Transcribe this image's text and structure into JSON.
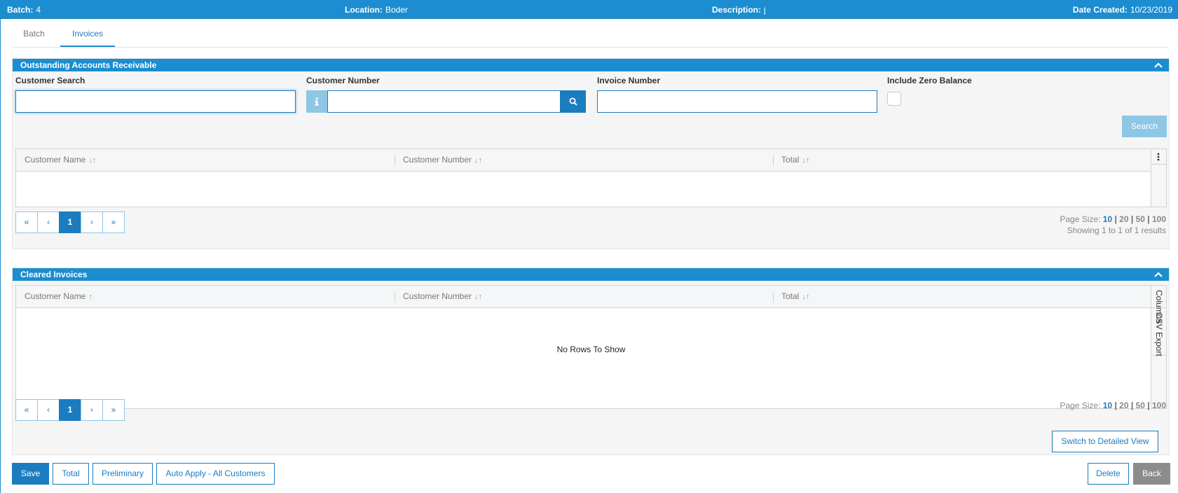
{
  "header": {
    "batch_label": "Batch:",
    "batch_value": "4",
    "location_label": "Location:",
    "location_value": "Boder",
    "description_label": "Description:",
    "description_value": "j",
    "date_label": "Date Created:",
    "date_value": "10/23/2019"
  },
  "tabs": [
    {
      "label": "Batch",
      "active": false
    },
    {
      "label": "Invoices",
      "active": true
    }
  ],
  "outstanding": {
    "title": "Outstanding Accounts Receivable",
    "customer_search_label": "Customer Search",
    "customer_search_value": "",
    "customer_number_label": "Customer Number",
    "customer_number_value": "",
    "invoice_number_label": "Invoice Number",
    "invoice_number_value": "",
    "include_zero_label": "Include Zero Balance",
    "include_zero_checked": false,
    "search_button": "Search",
    "columns": [
      {
        "label": "Customer Name",
        "sort": "↓↑"
      },
      {
        "label": "Customer Number",
        "sort": "↓↑"
      },
      {
        "label": "Total",
        "sort": "↓↑"
      }
    ],
    "pager": {
      "first": "«",
      "prev": "‹",
      "current": "1",
      "next": "›",
      "last": "»"
    },
    "page_size_label": "Page Size:",
    "page_sizes": [
      "10",
      "20",
      "50",
      "100"
    ],
    "page_size_selected": "10",
    "showing": "Showing 1 to 1 of 1 results"
  },
  "cleared": {
    "title": "Cleared Invoices",
    "columns": [
      {
        "label": "Customer Name",
        "sort": "↑"
      },
      {
        "label": "Customer Number",
        "sort": "↓↑"
      },
      {
        "label": "Total",
        "sort": "↓↑"
      }
    ],
    "side_tabs": [
      "Columns",
      "CSV Export"
    ],
    "empty_text": "No Rows To Show",
    "pager": {
      "first": "«",
      "prev": "‹",
      "current": "1",
      "next": "›",
      "last": "»"
    },
    "page_size_label": "Page Size:",
    "page_sizes": [
      "10",
      "20",
      "50",
      "100"
    ],
    "page_size_selected": "10",
    "switch_view_button": "Switch to Detailed View"
  },
  "footer": {
    "save": "Save",
    "total": "Total",
    "preliminary": "Preliminary",
    "auto_apply": "Auto Apply - All Customers",
    "delete": "Delete",
    "back": "Back"
  },
  "colors": {
    "primary": "#1b8dd0",
    "primary_dark": "#1b7cc0",
    "disabled": "#8ec6e6",
    "back_button": "#8c8c8c"
  },
  "icons": {
    "info_addon": "info-icon",
    "search_addon": "search-icon",
    "collapse": "chevron-up-icon",
    "grid_menu": "kebab-menu-icon"
  }
}
